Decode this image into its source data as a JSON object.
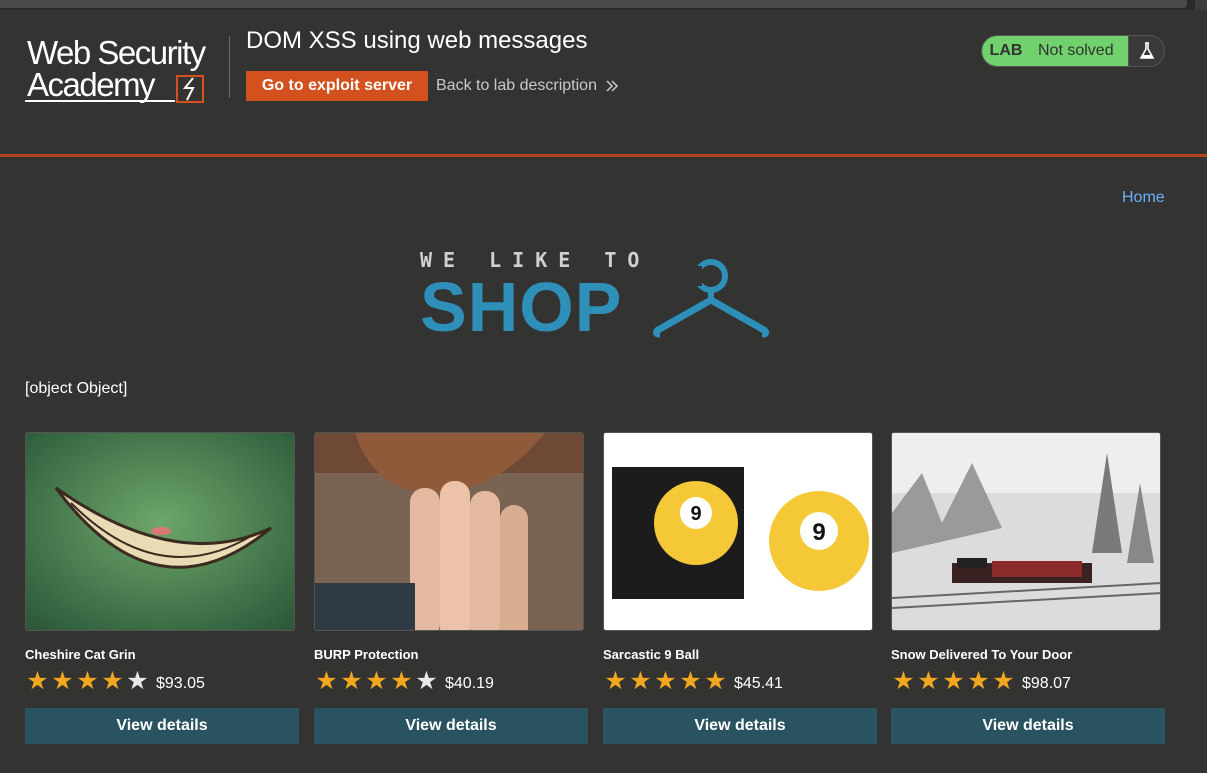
{
  "header": {
    "logo_line1": "Web Security",
    "logo_line2": "Academy",
    "lab_title": "DOM XSS using web messages",
    "exploit_button": "Go to exploit server",
    "back_link": "Back to lab description",
    "status_tag": "LAB",
    "status_text": "Not solved"
  },
  "nav": {
    "home": "Home"
  },
  "banner": {
    "tagline": "WE LIKE TO",
    "shop": "SHOP"
  },
  "message": "[object Object]",
  "products": [
    {
      "name": "Cheshire Cat Grin",
      "rating": 4,
      "price": "$93.05",
      "button": "View details"
    },
    {
      "name": "BURP Protection",
      "rating": 4,
      "price": "$40.19",
      "button": "View details"
    },
    {
      "name": "Sarcastic 9 Ball",
      "rating": 5,
      "price": "$45.41",
      "button": "View details"
    },
    {
      "name": "Snow Delivered To Your Door",
      "rating": 5,
      "price": "$98.07",
      "button": "View details"
    }
  ],
  "colors": {
    "background": "#333332",
    "accent_orange": "#d2511f",
    "status_green": "#70d16d",
    "link_blue": "#69b0ff",
    "button_teal": "#2a5361",
    "star_gold": "#f3a71e"
  }
}
